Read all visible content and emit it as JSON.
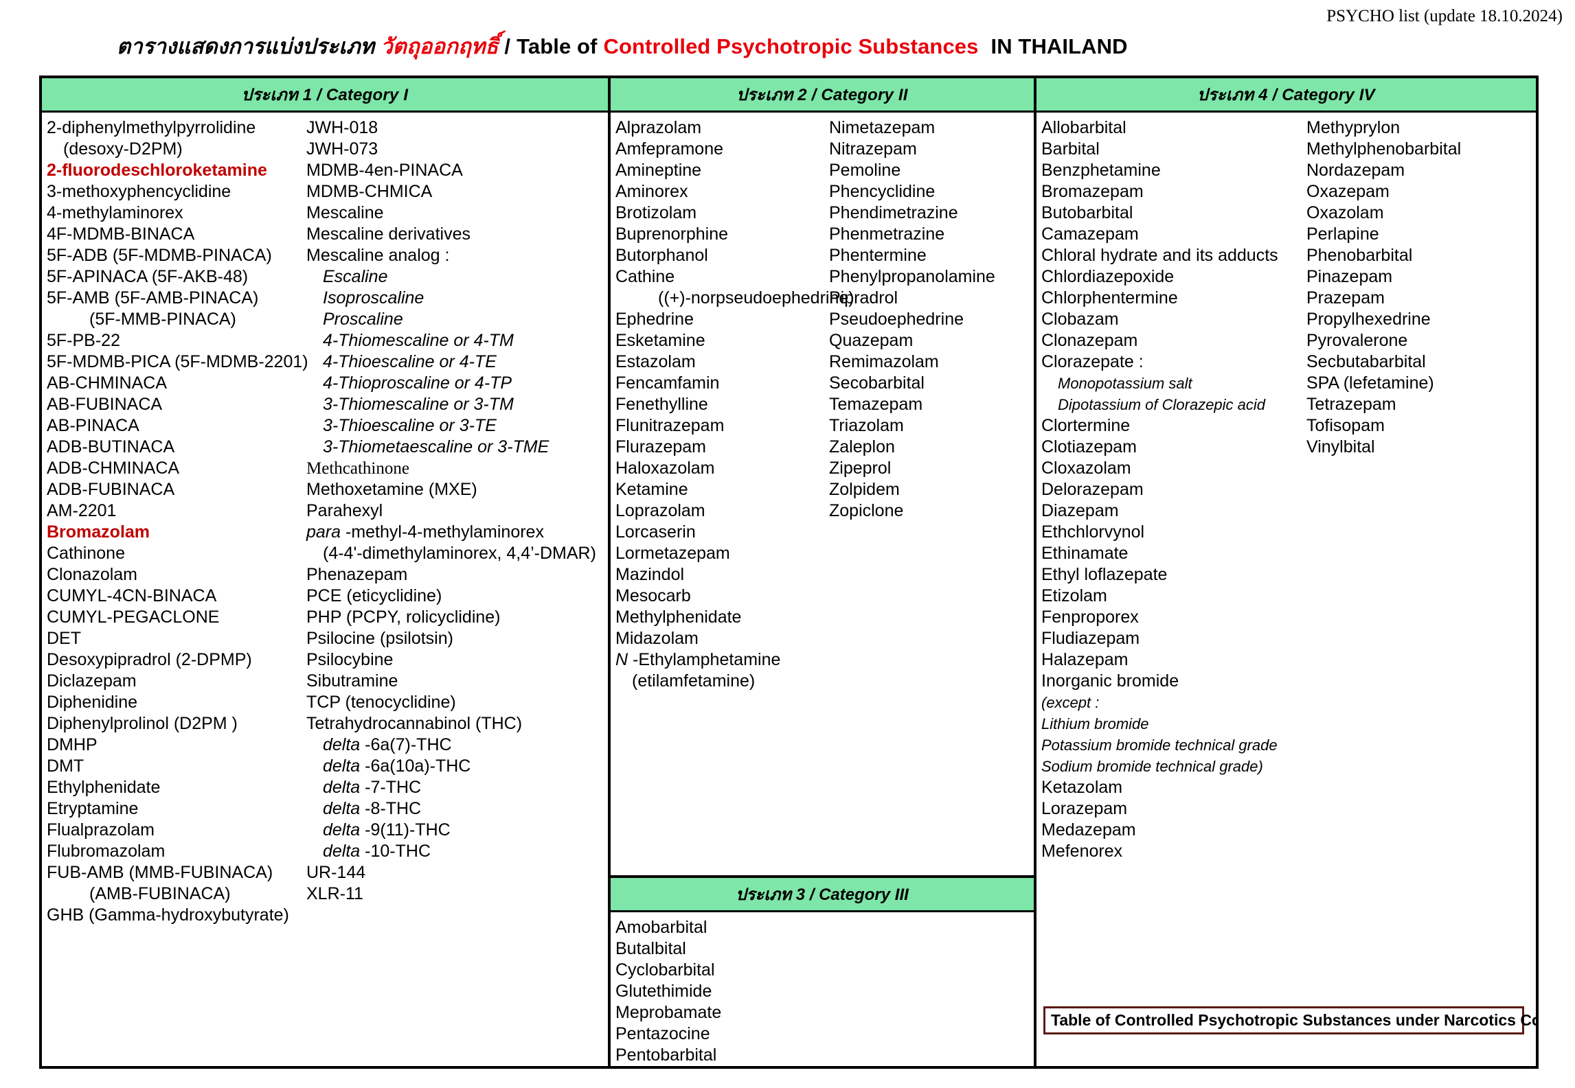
{
  "meta_line": "PSYCHO list (update 18.10.2024)",
  "title": {
    "thai_prefix": "ตารางแสดงการแบ่งประเภท",
    "thai_red": "วัตถุออกฤทธิ์",
    "slash": "/",
    "table_of": "Table of",
    "red_phrase": "Controlled Psychotropic Substances",
    "country": "IN THAILAND"
  },
  "colors": {
    "header_green": "#7ee6a8",
    "accent_red": "#e8000b",
    "entry_red": "#c00000",
    "note_border": "#5b1a12"
  },
  "categories": {
    "cat1": {
      "header": "ประเภท 1 / Category I",
      "col_a": [
        {
          "t": "2-diphenylmethylpyrrolidine"
        },
        {
          "t": "(desoxy-D2PM)",
          "ind": 1
        },
        {
          "t": "2-fluorodeschloroketamine",
          "red": true
        },
        {
          "t": "3-methoxyphencyclidine"
        },
        {
          "t": "4-methylaminorex"
        },
        {
          "t": "4F-MDMB-BINACA"
        },
        {
          "t": "5F-ADB (5F-MDMB-PINACA)"
        },
        {
          "t": "5F-APINACA (5F-AKB-48)"
        },
        {
          "t": "5F-AMB (5F-AMB-PINACA)"
        },
        {
          "t": "(5F-MMB-PINACA)",
          "ind": 2
        },
        {
          "t": "5F-PB-22"
        },
        {
          "t": "5F-MDMB-PICA (5F-MDMB-2201)"
        },
        {
          "t": "AB-CHMINACA"
        },
        {
          "t": "AB-FUBINACA"
        },
        {
          "t": "AB-PINACA"
        },
        {
          "t": "ADB-BUTINACA"
        },
        {
          "t": "ADB-CHMINACA"
        },
        {
          "t": "ADB-FUBINACA"
        },
        {
          "t": "AM-2201"
        },
        {
          "t": "Bromazolam",
          "red": true
        },
        {
          "t": "Cathinone"
        },
        {
          "t": "Clonazolam"
        },
        {
          "t": "CUMYL-4CN-BINACA"
        },
        {
          "t": "CUMYL-PEGACLONE"
        },
        {
          "t": "DET"
        },
        {
          "t": "Desoxypipradrol (2-DPMP)"
        },
        {
          "t": "Diclazepam"
        },
        {
          "t": "Diphenidine"
        },
        {
          "t": "Diphenylprolinol (D2PM )"
        },
        {
          "t": "DMHP"
        },
        {
          "t": "DMT"
        },
        {
          "t": "Ethylphenidate"
        },
        {
          "t": "Etryptamine"
        },
        {
          "t": "Flualprazolam"
        },
        {
          "t": "Flubromazolam"
        },
        {
          "t": "FUB-AMB (MMB-FUBINACA)"
        },
        {
          "t": "(AMB-FUBINACA)",
          "ind": 2
        },
        {
          "t": "GHB (Gamma-hydroxybutyrate)"
        }
      ],
      "col_b": [
        {
          "t": "JWH-018"
        },
        {
          "t": "JWH-073"
        },
        {
          "t": "MDMB-4en-PINACA"
        },
        {
          "t": "MDMB-CHMICA"
        },
        {
          "t": "Mescaline"
        },
        {
          "t": "Mescaline  derivatives"
        },
        {
          "t": "Mescaline  analog :"
        },
        {
          "t": "Escaline",
          "ind": 1,
          "ital": true
        },
        {
          "t": "Isoproscaline",
          "ind": 1,
          "ital": true
        },
        {
          "t": "Proscaline",
          "ind": 1,
          "ital": true
        },
        {
          "t": "4-Thiomescaline  or  4-TM",
          "ind": 1,
          "ital": true
        },
        {
          "t": "4-Thioescaline  or  4-TE",
          "ind": 1,
          "ital": true
        },
        {
          "t": "4-Thioproscaline  or  4-TP",
          "ind": 1,
          "ital": true
        },
        {
          "t": "3-Thiomescaline  or  3-TM",
          "ind": 1,
          "ital": true
        },
        {
          "t": "3-Thioescaline  or  3-TE",
          "ind": 1,
          "ital": true
        },
        {
          "t": "3-Thiometaescaline  or  3-TME",
          "ind": 1,
          "ital": true
        },
        {
          "t": "Methcathinone",
          "serif": true
        },
        {
          "t": "Methoxetamine (MXE)"
        },
        {
          "t": "Parahexyl"
        },
        {
          "t": "para -methyl-4-methylaminorex",
          "lead_ital": "para"
        },
        {
          "t": "(4-4'-dimethylaminorex, 4,4’-DMAR)",
          "ind": 1
        },
        {
          "t": "Phenazepam"
        },
        {
          "t": "PCE (eticyclidine)"
        },
        {
          "t": "PHP (PCPY, rolicyclidine)"
        },
        {
          "t": "Psilocine (psilotsin)"
        },
        {
          "t": "Psilocybine"
        },
        {
          "t": "Sibutramine"
        },
        {
          "t": "TCP (tenocyclidine)"
        },
        {
          "t": "Tetrahydrocannabinol (THC)"
        },
        {
          "t": "delta -6a(7)-THC",
          "ind": 1,
          "lead_ital": "delta"
        },
        {
          "t": "delta -6a(10a)-THC",
          "ind": 1,
          "lead_ital": "delta"
        },
        {
          "t": "delta -7-THC",
          "ind": 1,
          "lead_ital": "delta"
        },
        {
          "t": "delta -8-THC",
          "ind": 1,
          "lead_ital": "delta"
        },
        {
          "t": "delta -9(11)-THC",
          "ind": 1,
          "lead_ital": "delta"
        },
        {
          "t": "delta -10-THC",
          "ind": 1,
          "lead_ital": "delta"
        },
        {
          "t": "UR-144"
        },
        {
          "t": "XLR-11"
        }
      ]
    },
    "cat2": {
      "header": "ประเภท 2 / Category II",
      "col_a": [
        {
          "t": "Alprazolam"
        },
        {
          "t": "Amfepramone"
        },
        {
          "t": "Amineptine"
        },
        {
          "t": "Aminorex"
        },
        {
          "t": "Brotizolam"
        },
        {
          "t": "Buprenorphine"
        },
        {
          "t": "Butorphanol"
        },
        {
          "t": "Cathine"
        },
        {
          "t": "((+)-norpseudoephedrine)",
          "ind": 2
        },
        {
          "t": "Ephedrine"
        },
        {
          "t": "Esketamine"
        },
        {
          "t": "Estazolam"
        },
        {
          "t": "Fencamfamin"
        },
        {
          "t": "Fenethylline"
        },
        {
          "t": "Flunitrazepam"
        },
        {
          "t": "Flurazepam"
        },
        {
          "t": "Haloxazolam"
        },
        {
          "t": "Ketamine"
        },
        {
          "t": "Loprazolam"
        },
        {
          "t": "Lorcaserin"
        },
        {
          "t": "Lormetazepam"
        },
        {
          "t": "Mazindol"
        },
        {
          "t": "Mesocarb"
        },
        {
          "t": "Methylphenidate"
        },
        {
          "t": "Midazolam"
        },
        {
          "t": "N -Ethylamphetamine",
          "lead_ital": "N"
        },
        {
          "t": "(etilamfetamine)",
          "ind": 1
        }
      ],
      "col_b": [
        {
          "t": "Nimetazepam"
        },
        {
          "t": "Nitrazepam"
        },
        {
          "t": "Pemoline"
        },
        {
          "t": "Phencyclidine"
        },
        {
          "t": "Phendimetrazine"
        },
        {
          "t": "Phenmetrazine"
        },
        {
          "t": "Phentermine"
        },
        {
          "t": "Phenylpropanolamine"
        },
        {
          "t": "Pipradrol"
        },
        {
          "t": "Pseudoephedrine"
        },
        {
          "t": "Quazepam"
        },
        {
          "t": "Remimazolam"
        },
        {
          "t": "Secobarbital"
        },
        {
          "t": "Temazepam"
        },
        {
          "t": "Triazolam"
        },
        {
          "t": "Zaleplon"
        },
        {
          "t": "Zipeprol"
        },
        {
          "t": "Zolpidem"
        },
        {
          "t": "Zopiclone"
        }
      ]
    },
    "cat3": {
      "header": "ประเภท 3 / Category III",
      "items": [
        {
          "t": "Amobarbital"
        },
        {
          "t": "Butalbital"
        },
        {
          "t": "Cyclobarbital"
        },
        {
          "t": "Glutethimide"
        },
        {
          "t": "Meprobamate"
        },
        {
          "t": "Pentazocine"
        },
        {
          "t": "Pentobarbital"
        }
      ]
    },
    "cat4": {
      "header": "ประเภท 4 / Category IV",
      "col_a": [
        {
          "t": "Allobarbital"
        },
        {
          "t": "Barbital"
        },
        {
          "t": "Benzphetamine"
        },
        {
          "t": "Bromazepam"
        },
        {
          "t": "Butobarbital"
        },
        {
          "t": "Camazepam"
        },
        {
          "t": "Chloral hydrate and its adducts"
        },
        {
          "t": "Chlordiazepoxide"
        },
        {
          "t": "Chlorphentermine"
        },
        {
          "t": "Clobazam"
        },
        {
          "t": "Clonazepam"
        },
        {
          "t": "Clorazepate :"
        },
        {
          "t": "Monopotassium salt",
          "ind": 1,
          "small_ital": true
        },
        {
          "t": "Dipotassium of Clorazepic  acid",
          "ind": 1,
          "small_ital": true
        },
        {
          "t": "Clortermine"
        },
        {
          "t": "Clotiazepam"
        },
        {
          "t": "Cloxazolam"
        },
        {
          "t": "Delorazepam"
        },
        {
          "t": "Diazepam"
        },
        {
          "t": "Ethchlorvynol"
        },
        {
          "t": "Ethinamate"
        },
        {
          "t": "Ethyl loflazepate"
        },
        {
          "t": "Etizolam"
        },
        {
          "t": "Fenproporex"
        },
        {
          "t": "Fludiazepam"
        },
        {
          "t": "Halazepam"
        },
        {
          "t": "Inorganic bromide"
        },
        {
          "t": "(except  :",
          "small_ital": true
        },
        {
          "t": "Lithium bromide",
          "small_ital": true
        },
        {
          "t": "Potassium bromide technical grade",
          "small_ital": true
        },
        {
          "t": "Sodium bromide technical grade)",
          "small_ital": true
        },
        {
          "t": "Ketazolam"
        },
        {
          "t": "Lorazepam"
        },
        {
          "t": "Medazepam"
        },
        {
          "t": "Mefenorex"
        }
      ],
      "col_b": [
        {
          "t": "Methyprylon"
        },
        {
          "t": "Methylphenobarbital"
        },
        {
          "t": "Nordazepam"
        },
        {
          "t": "Oxazepam"
        },
        {
          "t": "Oxazolam"
        },
        {
          "t": "Perlapine"
        },
        {
          "t": "Phenobarbital"
        },
        {
          "t": "Pinazepam"
        },
        {
          "t": "Prazepam"
        },
        {
          "t": "Propylhexedrine"
        },
        {
          "t": "Pyrovalerone"
        },
        {
          "t": "Secbutabarbital"
        },
        {
          "t": "SPA (lefetamine)"
        },
        {
          "t": "Tetrazepam"
        },
        {
          "t": "Tofisopam"
        },
        {
          "t": "Vinylbital"
        }
      ],
      "footer_note": "Table of Controlled Psychotropic Substances under Narcotics Code"
    }
  }
}
